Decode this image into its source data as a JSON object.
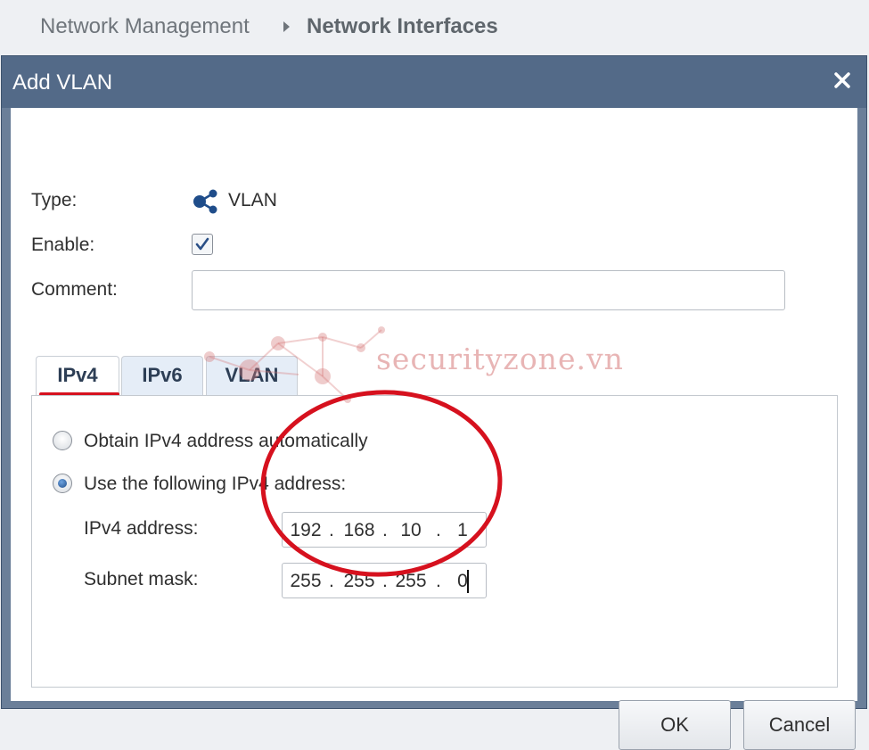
{
  "breadcrumb": {
    "parent": "Network Management",
    "current": "Network Interfaces"
  },
  "dialog": {
    "title": "Add VLAN",
    "close_icon": "close-icon"
  },
  "form": {
    "type_label": "Type:",
    "type_value": "VLAN",
    "type_icon": "vlan-share-icon",
    "enable_label": "Enable:",
    "enable_checked": true,
    "comment_label": "Comment:",
    "comment_value": "",
    "comment_placeholder": ""
  },
  "tabs": [
    {
      "label": "IPv4",
      "active": true
    },
    {
      "label": "IPv6",
      "active": false
    },
    {
      "label": "VLAN",
      "active": false
    }
  ],
  "ipv4": {
    "auto_label": "Obtain IPv4 address automatically",
    "manual_label": "Use the following IPv4 address:",
    "selected": "manual",
    "address_label": "IPv4 address:",
    "address": [
      "192",
      "168",
      "10",
      "1"
    ],
    "mask_label": "Subnet mask:",
    "mask": [
      "255",
      "255",
      "255",
      "0"
    ]
  },
  "buttons": {
    "ok": "OK",
    "cancel": "Cancel"
  },
  "watermark": {
    "text": "securityzone.vn"
  },
  "colors": {
    "titlebar": "#536a88",
    "annotation": "#d6111e",
    "tab_active_underline": "#d6111e"
  }
}
